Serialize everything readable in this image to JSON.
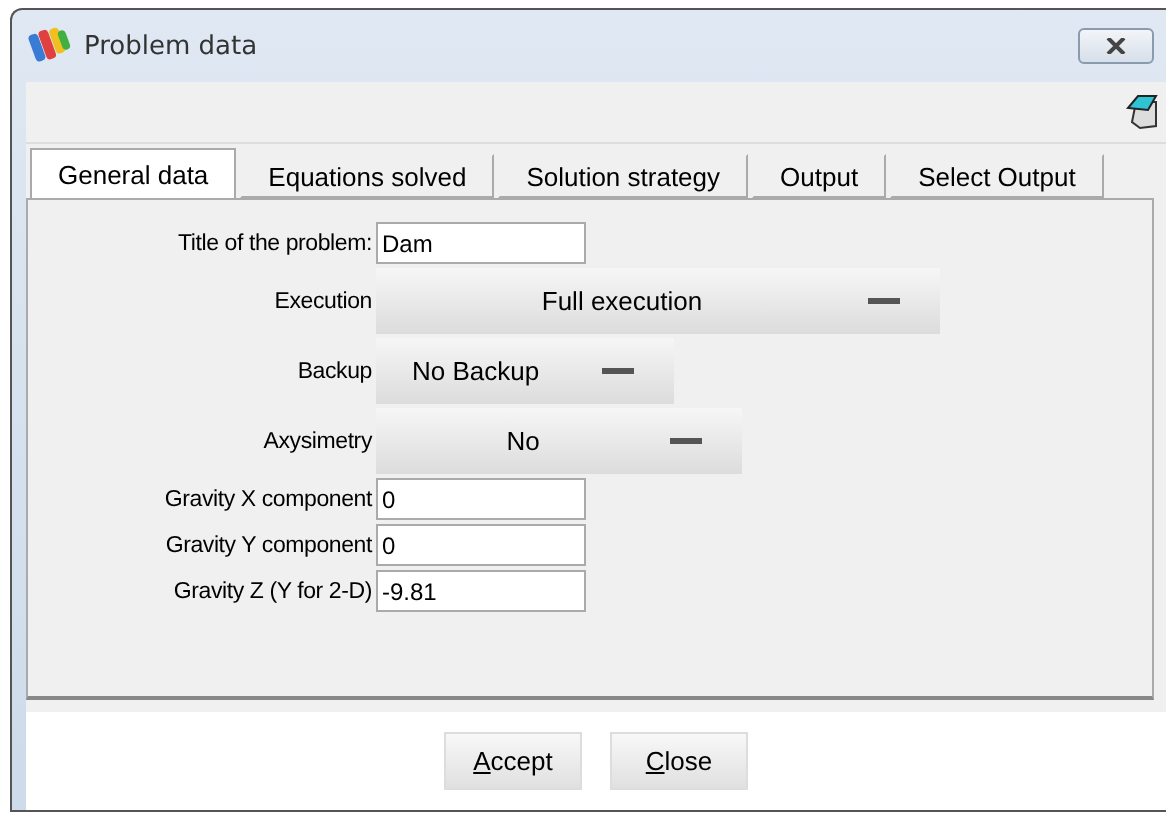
{
  "window": {
    "title": "Problem data"
  },
  "tabs": [
    {
      "label": "General data",
      "selected": true
    },
    {
      "label": "Equations solved",
      "selected": false
    },
    {
      "label": "Solution strategy",
      "selected": false
    },
    {
      "label": "Output",
      "selected": false
    },
    {
      "label": "Select Output",
      "selected": false
    }
  ],
  "fields": [
    {
      "kind": "input",
      "label": "Title of the problem:",
      "value": "Dam"
    },
    {
      "kind": "menu",
      "label": "Execution",
      "value": "Full execution"
    },
    {
      "kind": "menu",
      "label": "Backup",
      "value": "No Backup"
    },
    {
      "kind": "menu",
      "label": "Axysimetry",
      "value": "No"
    },
    {
      "kind": "input",
      "label": "Gravity X component",
      "value": "0"
    },
    {
      "kind": "input",
      "label": "Gravity Y component",
      "value": "0"
    },
    {
      "kind": "input",
      "label": "Gravity Z (Y for 2-D)",
      "value": "-9.81"
    }
  ],
  "buttons": [
    "Accept",
    "Close"
  ]
}
